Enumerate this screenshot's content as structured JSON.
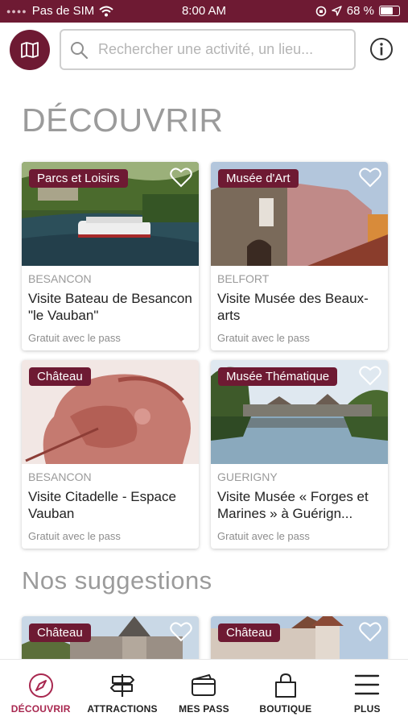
{
  "status_bar": {
    "carrier": "Pas de SIM",
    "time": "8:00 AM",
    "battery": "68 %"
  },
  "search": {
    "placeholder": "Rechercher une activité, un lieu..."
  },
  "sections": {
    "discover_title": "DÉCOUVRIR",
    "suggestions_title": "Nos suggestions"
  },
  "cards": [
    {
      "tag": "Parcs et Loisirs",
      "city": "BESANCON",
      "name": "Visite Bateau de Besancon \"le Vauban\"",
      "price": "Gratuit avec le pass"
    },
    {
      "tag": "Musée d'Art",
      "city": "BELFORT",
      "name": "Visite Musée des Beaux-arts",
      "price": "Gratuit avec le pass"
    },
    {
      "tag": "Château",
      "city": "BESANCON",
      "name": "Visite Citadelle - Espace Vauban",
      "price": "Gratuit avec le pass"
    },
    {
      "tag": "Musée Thématique",
      "city": "GUERIGNY",
      "name": "Visite Musée « Forges et Marines » à Guérign...",
      "price": "Gratuit avec le pass"
    }
  ],
  "suggestions": [
    {
      "tag": "Château"
    },
    {
      "tag": "Château"
    }
  ],
  "tabs": [
    {
      "label": "DÉCOUVRIR",
      "icon": "compass-icon"
    },
    {
      "label": "ATTRACTIONS",
      "icon": "signpost-icon"
    },
    {
      "label": "MES PASS",
      "icon": "wallet-icon"
    },
    {
      "label": "BOUTIQUE",
      "icon": "shopping-bag-icon"
    },
    {
      "label": "PLUS",
      "icon": "menu-icon"
    }
  ],
  "colors": {
    "brand": "#6e1a33",
    "active_tab": "#a8274f"
  }
}
